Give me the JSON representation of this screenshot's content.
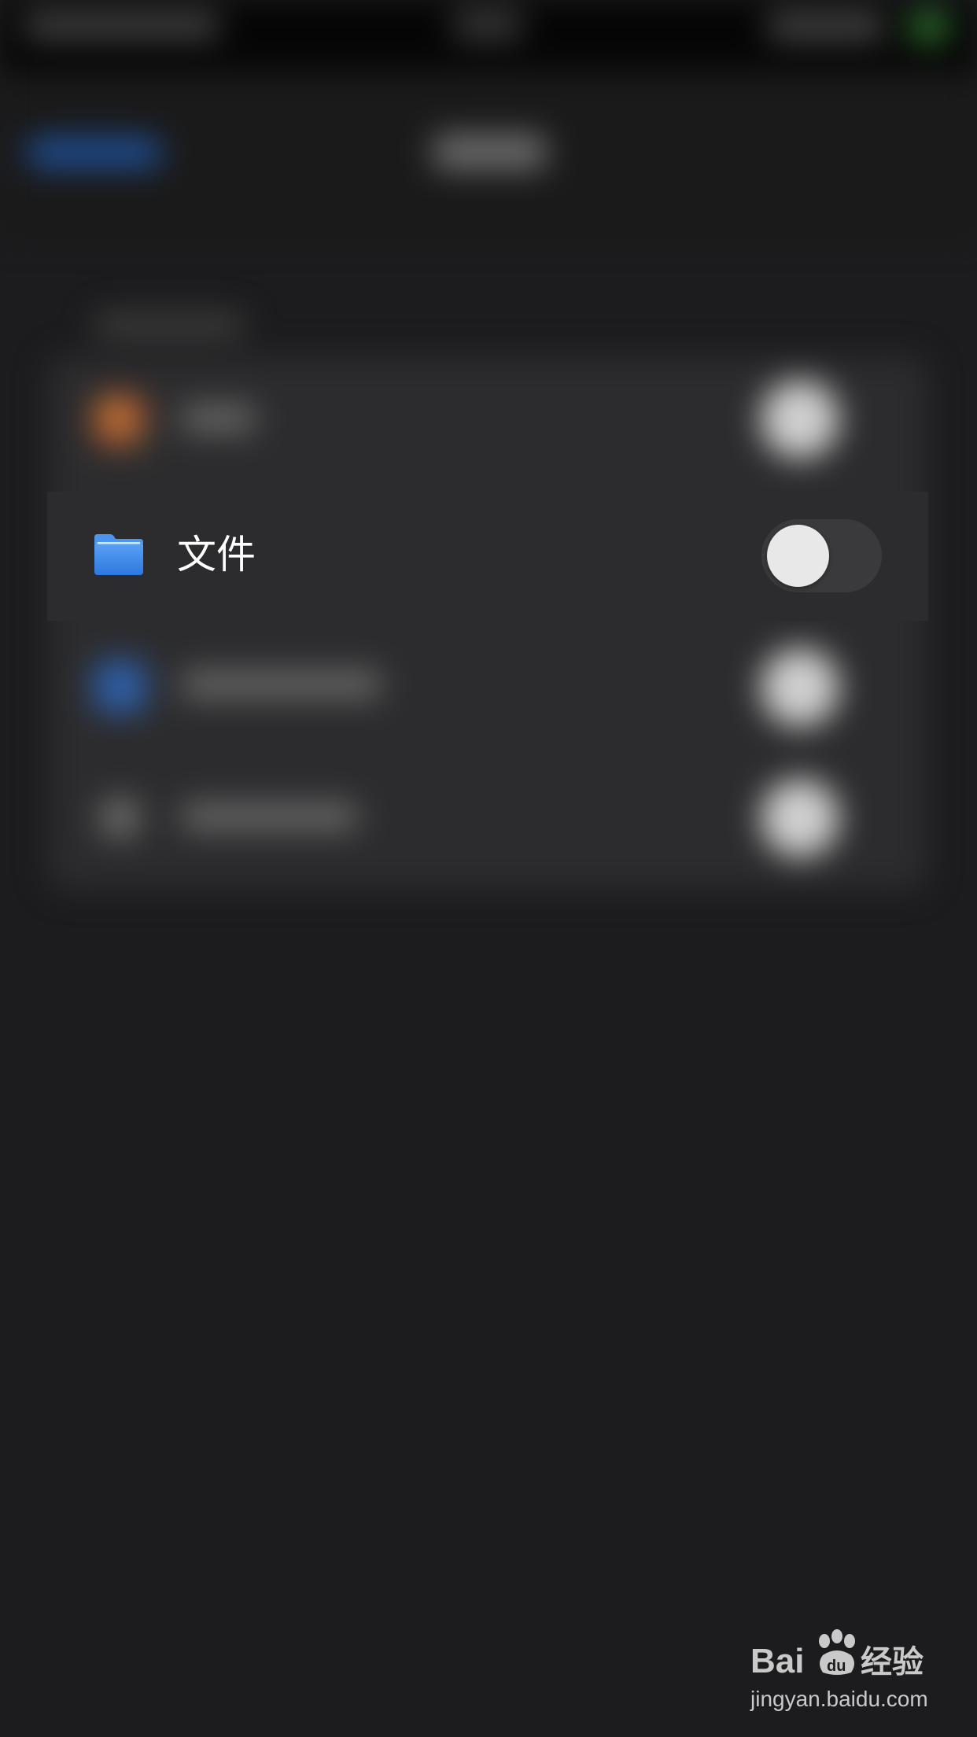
{
  "focused_row": {
    "icon": "folder-icon",
    "label": "文件",
    "toggle_on": false
  },
  "colors": {
    "background": "#1c1c1e",
    "row_background": "#2c2c2e",
    "toggle_off_track": "#3a3a3c",
    "toggle_knob": "#e8e8e8",
    "folder_blue": "#3d86ea",
    "label_text": "#ffffff"
  },
  "watermark": {
    "logo_text": "Bai du 经验",
    "url": "jingyan.baidu.com"
  }
}
